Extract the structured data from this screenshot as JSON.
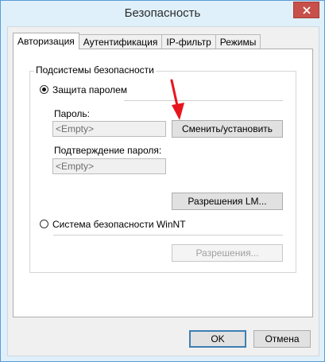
{
  "window": {
    "title": "Безопасность"
  },
  "tabs": [
    {
      "label": "Авторизация",
      "active": true
    },
    {
      "label": "Аутентификация",
      "active": false
    },
    {
      "label": "IP-фильтр",
      "active": false
    },
    {
      "label": "Режимы",
      "active": false
    }
  ],
  "group": {
    "title": "Подсистемы безопасности",
    "password_radio": {
      "label": "Защита паролем",
      "checked": true
    },
    "password_label": "Пароль:",
    "password_value": "<Empty>",
    "change_button": "Сменить/установить",
    "confirm_label": "Подтверждение пароля:",
    "confirm_value": "<Empty>",
    "lm_button": "Разрешения LM...",
    "winnt_radio": {
      "label": "Система безопасности WinNT",
      "checked": false
    },
    "permissions_button": "Разрешения..."
  },
  "footer": {
    "ok_label": "OK",
    "cancel_label": "Отмена"
  },
  "colors": {
    "accent": "#3c7fb1",
    "close": "#c7504a",
    "arrow": "#e8141d"
  }
}
